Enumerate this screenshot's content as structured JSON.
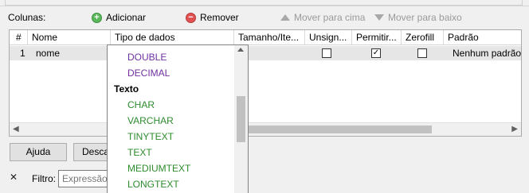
{
  "toolbar": {
    "columns_label": "Colunas:",
    "add_label": "Adicionar",
    "remove_label": "Remover",
    "move_up_label": "Mover para cima",
    "move_down_label": "Mover para baixo"
  },
  "grid": {
    "headers": [
      "#",
      "Nome",
      "Tipo de dados",
      "Tamanho/Ite...",
      "Unsign...",
      "Permitir...",
      "Zerofill",
      "Padrão"
    ],
    "rows": [
      {
        "index": "1",
        "name": "nome",
        "unsigned": false,
        "allow_null": true,
        "zerofill": false,
        "default": "Nenhum padrão"
      }
    ]
  },
  "dropdown": {
    "type_colors": {
      "numeric": "#7030a0",
      "text": "#2e8b2e"
    },
    "items_before": [
      "DOUBLE",
      "DECIMAL"
    ],
    "group_label": "Texto",
    "text_items": [
      "CHAR",
      "VARCHAR",
      "TINYTEXT",
      "TEXT",
      "MEDIUMTEXT",
      "LONGTEXT"
    ]
  },
  "buttons": {
    "help_label": "Ajuda",
    "discard_label": "Desca"
  },
  "filter": {
    "label": "Filtro:",
    "placeholder": "Expressão r"
  }
}
